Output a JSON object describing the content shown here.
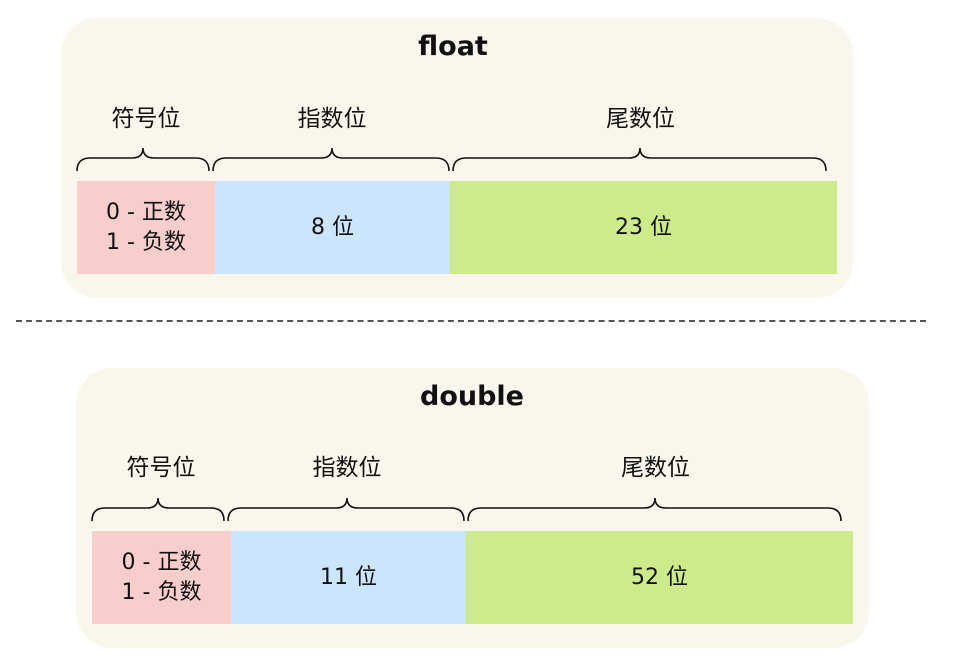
{
  "float": {
    "title": "float",
    "labels": {
      "sign": "符号位",
      "exponent": "指数位",
      "mantissa": "尾数位"
    },
    "cells": {
      "sign_line1": "0 - 正数",
      "sign_line2": "1 - 负数",
      "exponent": "8 位",
      "mantissa": "23 位"
    }
  },
  "double": {
    "title": "double",
    "labels": {
      "sign": "符号位",
      "exponent": "指数位",
      "mantissa": "尾数位"
    },
    "cells": {
      "sign_line1": "0 - 正数",
      "sign_line2": "1 - 负数",
      "exponent": "11 位",
      "mantissa": "52 位"
    }
  },
  "colors": {
    "panel_background": "#f9f7ed",
    "sign_cell": "#f8cecc",
    "exponent_cell": "#cce5ff",
    "mantissa_cell": "#cdeb8b"
  }
}
